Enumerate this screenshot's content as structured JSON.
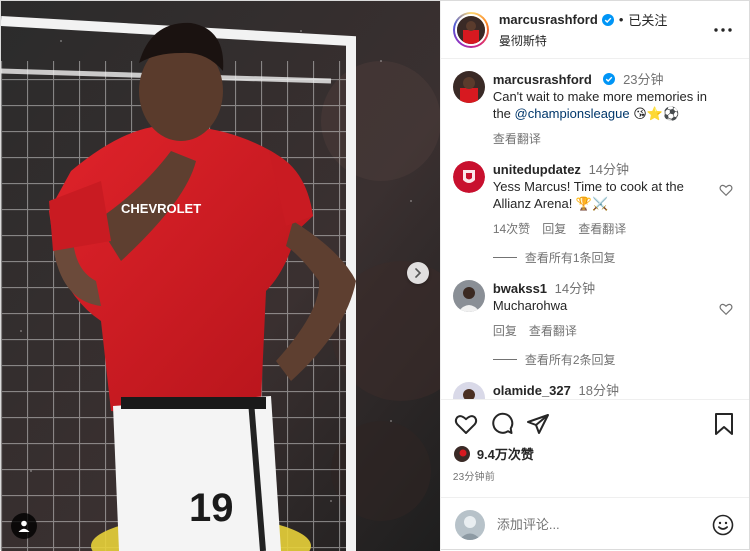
{
  "post": {
    "author": "marcusrashford",
    "follow_state": "已关注",
    "separator": "•",
    "location": "曼彻斯特",
    "likes": "9.4万次赞",
    "time_ago": "23分钟前"
  },
  "media": {
    "jersey_sponsor": "CHEVROLET",
    "shirt_number": "19"
  },
  "caption": {
    "user": "marcusrashford",
    "time": "23分钟",
    "text_pre": "Can't wait to make more memories in the ",
    "mention": "@championsleague",
    "emojis": " 😘⭐⚽",
    "translate": "查看翻译"
  },
  "comments": [
    {
      "user": "unitedupdatez",
      "time": "14分钟",
      "text": "Yess Marcus! Time to cook at the Allianz Arena! 🏆⚔️",
      "likes": "14次赞",
      "reply": "回复",
      "translate": "查看翻译",
      "view_replies": "查看所有1条回复"
    },
    {
      "user": "bwakss1",
      "time": "14分钟",
      "text": "Mucharohwa",
      "reply": "回复",
      "translate": "查看翻译",
      "view_replies": "查看所有2条回复"
    },
    {
      "user": "olamide_327",
      "time": "18分钟",
      "text": ""
    }
  ],
  "composer": {
    "placeholder": "添加评论..."
  },
  "colors": {
    "verified": "#0095f6",
    "mention": "#00376b",
    "jersey_red": "#d71920"
  }
}
